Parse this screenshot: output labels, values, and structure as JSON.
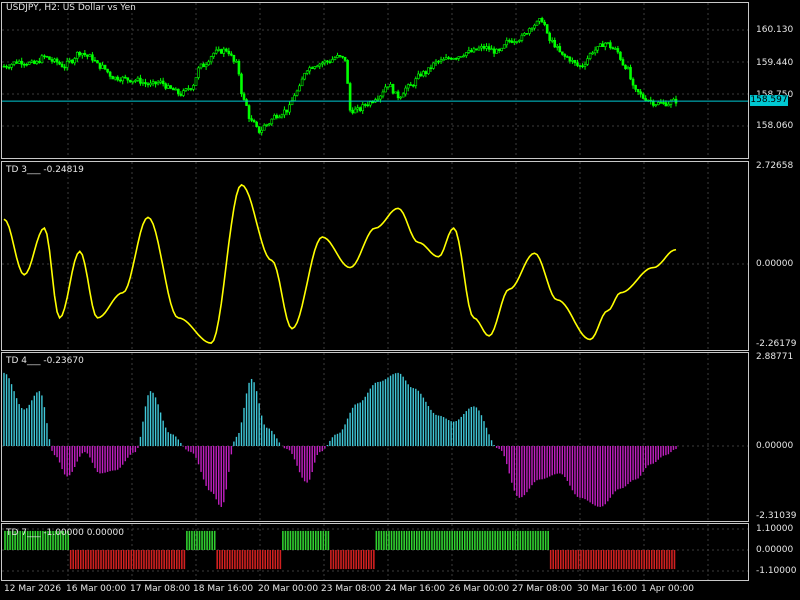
{
  "colors": {
    "background": "#000000",
    "border": "#c8c8c8",
    "grid": "#3c3c3c",
    "candle": "#00ff00",
    "current_price_line": "#00c8d2",
    "td3_line": "#ffff00",
    "hist_positive": "#40c8d8",
    "hist_negative": "#c020c0",
    "signal_positive": "#30d030",
    "signal_negative": "#d02020"
  },
  "main": {
    "title": "USDJPY, H2:  US Dollar vs Yen",
    "price_labels": [
      "160.130",
      "159.440",
      "158.750",
      "158.060"
    ],
    "current_price": "158.597"
  },
  "td3": {
    "title": "TD 3___  -0.24819",
    "scale_labels": [
      "2.72658",
      "0.00000",
      "-2.26179"
    ]
  },
  "td4": {
    "title": "TD 4___  -0.23670",
    "scale_labels": [
      "2.88771",
      "0.00000",
      "-2.31039"
    ]
  },
  "td7": {
    "title": "TD 7___  -1.00000 0.00000",
    "scale_labels": [
      "1.10000",
      "0.00000",
      "-1.10000"
    ]
  },
  "time_axis": [
    "12 Mar 2026",
    "16 Mar 00:00",
    "17 Mar 08:00",
    "18 Mar 16:00",
    "20 Mar 00:00",
    "23 Mar 08:00",
    "24 Mar 16:00",
    "26 Mar 00:00",
    "27 Mar 08:00",
    "30 Mar 16:00",
    "1 Apr 00:00"
  ],
  "chart_data": [
    {
      "type": "candlestick",
      "title": "USDJPY, H2:  US Dollar vs Yen",
      "ylim": [
        157.9,
        160.4
      ],
      "y_ticks": [
        160.13,
        159.44,
        158.75,
        158.06
      ],
      "current_price": 158.597,
      "close_path_anchors": [
        [
          0,
          159.35
        ],
        [
          6,
          159.45
        ],
        [
          12,
          159.4
        ],
        [
          16,
          159.55
        ],
        [
          20,
          159.45
        ],
        [
          24,
          159.35
        ],
        [
          26,
          159.45
        ],
        [
          30,
          159.65
        ],
        [
          34,
          159.55
        ],
        [
          38,
          159.35
        ],
        [
          44,
          159.1
        ],
        [
          52,
          159.05
        ],
        [
          58,
          158.95
        ],
        [
          62,
          159.0
        ],
        [
          66,
          158.85
        ],
        [
          70,
          158.75
        ],
        [
          74,
          158.9
        ],
        [
          78,
          159.35
        ],
        [
          84,
          159.65
        ],
        [
          88,
          159.7
        ],
        [
          92,
          159.4
        ],
        [
          95,
          158.6
        ],
        [
          98,
          158.15
        ],
        [
          101,
          157.95
        ],
        [
          104,
          158.1
        ],
        [
          108,
          158.3
        ],
        [
          112,
          158.4
        ],
        [
          116,
          158.8
        ],
        [
          120,
          159.3
        ],
        [
          124,
          159.4
        ],
        [
          128,
          159.45
        ],
        [
          132,
          159.55
        ],
        [
          135,
          159.5
        ],
        [
          137,
          158.4
        ],
        [
          140,
          158.4
        ],
        [
          144,
          158.55
        ],
        [
          148,
          158.7
        ],
        [
          152,
          158.95
        ],
        [
          156,
          158.7
        ],
        [
          160,
          158.9
        ],
        [
          166,
          159.2
        ],
        [
          172,
          159.45
        ],
        [
          178,
          159.55
        ],
        [
          184,
          159.65
        ],
        [
          190,
          159.75
        ],
        [
          196,
          159.65
        ],
        [
          200,
          159.9
        ],
        [
          204,
          159.95
        ],
        [
          210,
          160.25
        ],
        [
          213,
          160.35
        ],
        [
          216,
          159.9
        ],
        [
          222,
          159.55
        ],
        [
          228,
          159.35
        ],
        [
          234,
          159.7
        ],
        [
          238,
          159.85
        ],
        [
          242,
          159.7
        ],
        [
          246,
          159.35
        ],
        [
          250,
          158.8
        ],
        [
          254,
          158.65
        ],
        [
          258,
          158.55
        ],
        [
          262,
          158.55
        ],
        [
          266,
          158.6
        ]
      ]
    },
    {
      "type": "line",
      "title": "TD 3",
      "last_value": -0.24819,
      "ylim": [
        -2.26179,
        2.72658
      ],
      "x_range": [
        0,
        266
      ],
      "x": [
        0,
        8,
        16,
        22,
        30,
        37,
        47,
        57,
        69,
        82,
        94,
        106,
        114,
        126,
        137,
        147,
        156,
        164,
        172,
        178,
        186,
        192,
        200,
        210,
        219,
        232,
        239,
        244,
        257,
        266
      ],
      "y": [
        1.25,
        -0.3,
        1.0,
        -1.5,
        0.35,
        -1.5,
        -0.8,
        1.3,
        -1.5,
        -2.2,
        2.2,
        0.1,
        -1.8,
        0.75,
        -0.1,
        1.0,
        1.55,
        0.6,
        0.2,
        1.0,
        -1.5,
        -2.0,
        -0.7,
        0.3,
        -1.0,
        -2.1,
        -1.3,
        -0.8,
        -0.1,
        0.4
      ]
    },
    {
      "type": "bar",
      "title": "TD 4",
      "last_value": -0.2367,
      "ylim": [
        -2.31039,
        2.88771
      ],
      "x": [
        0,
        8,
        14,
        20,
        25,
        32,
        38,
        44,
        52,
        58,
        66,
        74,
        82,
        86,
        92,
        98,
        104,
        112,
        120,
        125,
        132,
        140,
        148,
        156,
        162,
        172,
        178,
        186,
        196,
        204,
        212,
        220,
        228,
        236,
        244,
        250,
        256,
        262,
        266
      ],
      "y": [
        2.4,
        1.2,
        1.8,
        -0.3,
        -1.0,
        -0.2,
        -0.9,
        -0.8,
        -0.2,
        1.8,
        0.4,
        -0.2,
        -1.5,
        -2.0,
        0.3,
        2.2,
        0.6,
        -0.1,
        -1.2,
        -0.2,
        0.4,
        1.4,
        2.1,
        2.4,
        1.9,
        1.0,
        0.8,
        1.3,
        -0.1,
        -1.7,
        -1.1,
        -0.9,
        -1.7,
        -2.0,
        -1.4,
        -1.1,
        -0.6,
        -0.3,
        -0.1
      ]
    },
    {
      "type": "bar",
      "title": "TD 7",
      "values_shown": [
        -1.0,
        0.0
      ],
      "ylim": [
        -1.1,
        1.1
      ],
      "y_ticks": [
        1.1,
        0.0,
        -1.1
      ],
      "segments": [
        {
          "from": 0,
          "to": 26,
          "value": 1
        },
        {
          "from": 26,
          "to": 72,
          "value": -1
        },
        {
          "from": 72,
          "to": 84,
          "value": 1
        },
        {
          "from": 84,
          "to": 110,
          "value": -1
        },
        {
          "from": 110,
          "to": 129,
          "value": 1
        },
        {
          "from": 129,
          "to": 147,
          "value": -1
        },
        {
          "from": 147,
          "to": 216,
          "value": 1
        },
        {
          "from": 216,
          "to": 266,
          "value": -1
        }
      ]
    }
  ]
}
